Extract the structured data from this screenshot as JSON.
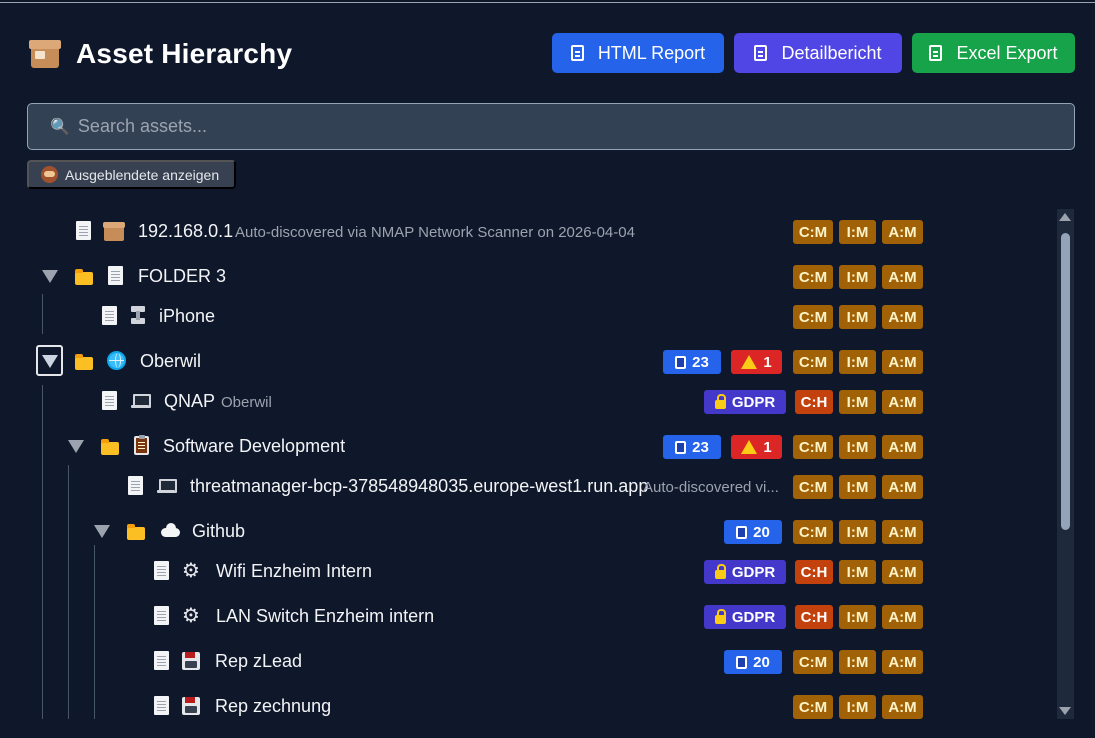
{
  "header": {
    "title": "Asset Hierarchy",
    "buttons": {
      "html_report": "HTML Report",
      "detail_report": "Detailbericht",
      "excel_export": "Excel Export"
    }
  },
  "search": {
    "placeholder": "Search assets...",
    "value": ""
  },
  "toggle_hidden": {
    "label": "Ausgeblendete anzeigen"
  },
  "tree": {
    "rows": [
      {
        "name": "192.168.0.1",
        "sub": "Auto-discovered via NMAP Network Scanner on 2026-04-04",
        "c": "C:M",
        "i": "I:M",
        "a": "A:M"
      },
      {
        "name": "FOLDER 3",
        "c": "C:M",
        "i": "I:M",
        "a": "A:M"
      },
      {
        "name": "iPhone",
        "c": "C:M",
        "i": "I:M",
        "a": "A:M"
      },
      {
        "name": "Oberwil",
        "count": "23",
        "warn": "1",
        "c": "C:M",
        "i": "I:M",
        "a": "A:M"
      },
      {
        "name": "QNAP",
        "sub": "Oberwil",
        "gdpr": "GDPR",
        "c": "C:H",
        "i": "I:M",
        "a": "A:M"
      },
      {
        "name": "Software Development",
        "count": "23",
        "warn": "1",
        "c": "C:M",
        "i": "I:M",
        "a": "A:M"
      },
      {
        "name": "threatmanager-bcp-378548948035.europe-west1.run.app",
        "sub": "Auto-discovered vi...",
        "c": "C:M",
        "i": "I:M",
        "a": "A:M"
      },
      {
        "name": "Github",
        "count": "20",
        "c": "C:M",
        "i": "I:M",
        "a": "A:M"
      },
      {
        "name": "Wifi Enzheim Intern",
        "gdpr": "GDPR",
        "c": "C:H",
        "i": "I:M",
        "a": "A:M"
      },
      {
        "name": "LAN Switch Enzheim intern",
        "gdpr": "GDPR",
        "c": "C:H",
        "i": "I:M",
        "a": "A:M"
      },
      {
        "name": "Rep zLead",
        "count": "20",
        "c": "C:M",
        "i": "I:M",
        "a": "A:M"
      },
      {
        "name": "Rep zechnung",
        "c": "C:M",
        "i": "I:M",
        "a": "A:M"
      }
    ]
  },
  "colors": {
    "background": "#0f172a",
    "html_report": "#2563eb",
    "detail_report": "#4f46e5",
    "excel_export": "#16a34a",
    "rating_medium": "#a16207",
    "rating_high": "#c2410c",
    "gdpr": "#4338ca",
    "count": "#2563eb",
    "warning": "#dc2626"
  },
  "icons": [
    "package-icon",
    "document-icon",
    "folder-icon",
    "globe-icon",
    "laptop-icon",
    "clipboard-icon",
    "cloud-icon",
    "gear-icon",
    "floppy-disk-icon",
    "network-jack-icon",
    "caret-down-icon",
    "search-icon",
    "lock-icon",
    "warning-icon",
    "monkey-icon"
  ]
}
